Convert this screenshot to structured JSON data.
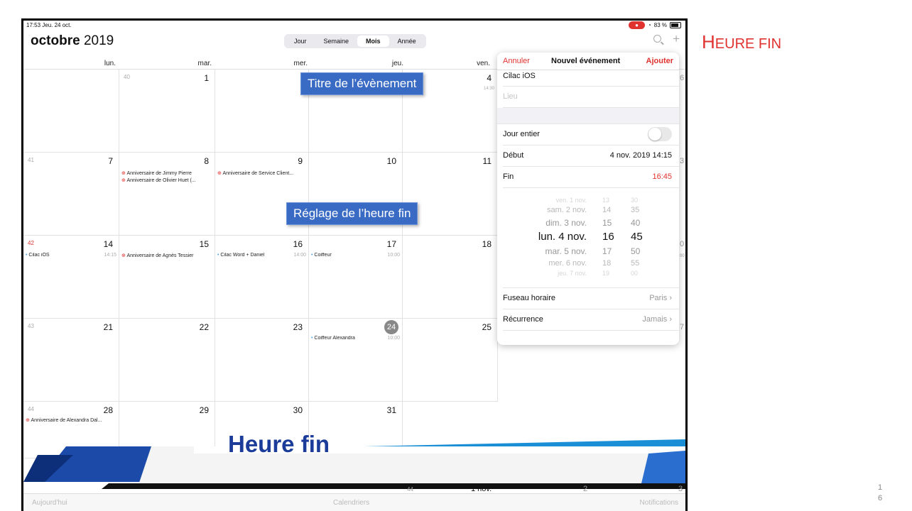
{
  "status": {
    "time_date": "17:53  Jeu. 24 oct.",
    "battery": "83 %"
  },
  "calendar": {
    "month_bold": "octobre",
    "year": "2019",
    "views": [
      "Jour",
      "Semaine",
      "Mois",
      "Année"
    ],
    "active_view": "Mois",
    "weekdays": [
      "lun.",
      "mar.",
      "mer.",
      "jeu.",
      "ven."
    ],
    "weeks": [
      {
        "wk": "40",
        "days": [
          "",
          "1",
          "",
          "",
          "4"
        ],
        "extra": "14:30",
        "side": "6"
      },
      {
        "wk": "41",
        "days": [
          "7",
          "8",
          "9",
          "10",
          "11"
        ],
        "side": "3"
      },
      {
        "wk": "42",
        "days": [
          "14",
          "15",
          "16",
          "17",
          "18"
        ],
        "side": "0"
      },
      {
        "wk": "43",
        "days": [
          "21",
          "22",
          "23",
          "24",
          "25"
        ],
        "side": "7"
      },
      {
        "wk": "44",
        "days": [
          "28",
          "29",
          "30",
          "31",
          ""
        ]
      }
    ],
    "events": {
      "e1": "Anniversaire de Jimmy Pierre",
      "e2": "Anniversaire de Olivier Huet (...",
      "e3": "Anniversaire de Service Client...",
      "e4": "Cilac iOS",
      "e4t": "14:15",
      "e5": "Anniversaire de Agnès Tessier",
      "e6": "Cilac Word + Daniel",
      "e6t": "14:00",
      "e7": "Coiffeur",
      "e7t": "10:00",
      "e8": "Coiffeur Alexandra",
      "e8t": "10:00",
      "e9": "Anniversaire de Alexandra Dal...",
      "side_time": "00"
    },
    "footer_row": {
      "wk": "44",
      "day": "1 nov.",
      "d2": "2",
      "d3": "3"
    }
  },
  "panel": {
    "cancel": "Annuler",
    "title": "Nouvel événement",
    "add": "Ajouter",
    "event_title": "Cilac iOS",
    "location_placeholder": "Lieu",
    "all_day_label": "Jour entier",
    "start_label": "Début",
    "start_value": "4 nov. 2019   14:15",
    "end_label": "Fin",
    "end_value": "16:45",
    "picker": [
      {
        "d": "ven. 1 nov.",
        "h": "13",
        "m": "30"
      },
      {
        "d": "sam. 2 nov.",
        "h": "14",
        "m": "35"
      },
      {
        "d": "dim. 3 nov.",
        "h": "15",
        "m": "40"
      },
      {
        "d": "lun. 4 nov.",
        "h": "16",
        "m": "45"
      },
      {
        "d": "mar. 5 nov.",
        "h": "17",
        "m": "50"
      },
      {
        "d": "mer. 6 nov.",
        "h": "18",
        "m": "55"
      },
      {
        "d": "jeu. 7 nov.",
        "h": "19",
        "m": "00"
      }
    ],
    "timezone_label": "Fuseau horaire",
    "timezone_value": "Paris",
    "recurrence_label": "Récurrence",
    "recurrence_value": "Jamais"
  },
  "callouts": {
    "title_callout": "Titre de l’évènement",
    "end_callout": "Réglage de l’heure fin"
  },
  "banner": {
    "text": "Heure fin"
  },
  "bottom": {
    "today": "Aujourd'hui",
    "calendars": "Calendriers",
    "notifications": "Notifications"
  },
  "slide": {
    "title_first": "H",
    "title_rest": "EURE FIN",
    "page_num_1": "1",
    "page_num_2": "6"
  },
  "colors": {
    "accent_red": "#e0322f",
    "callout_blue": "#3a6bc4",
    "banner_blue": "#1c3c9a"
  }
}
